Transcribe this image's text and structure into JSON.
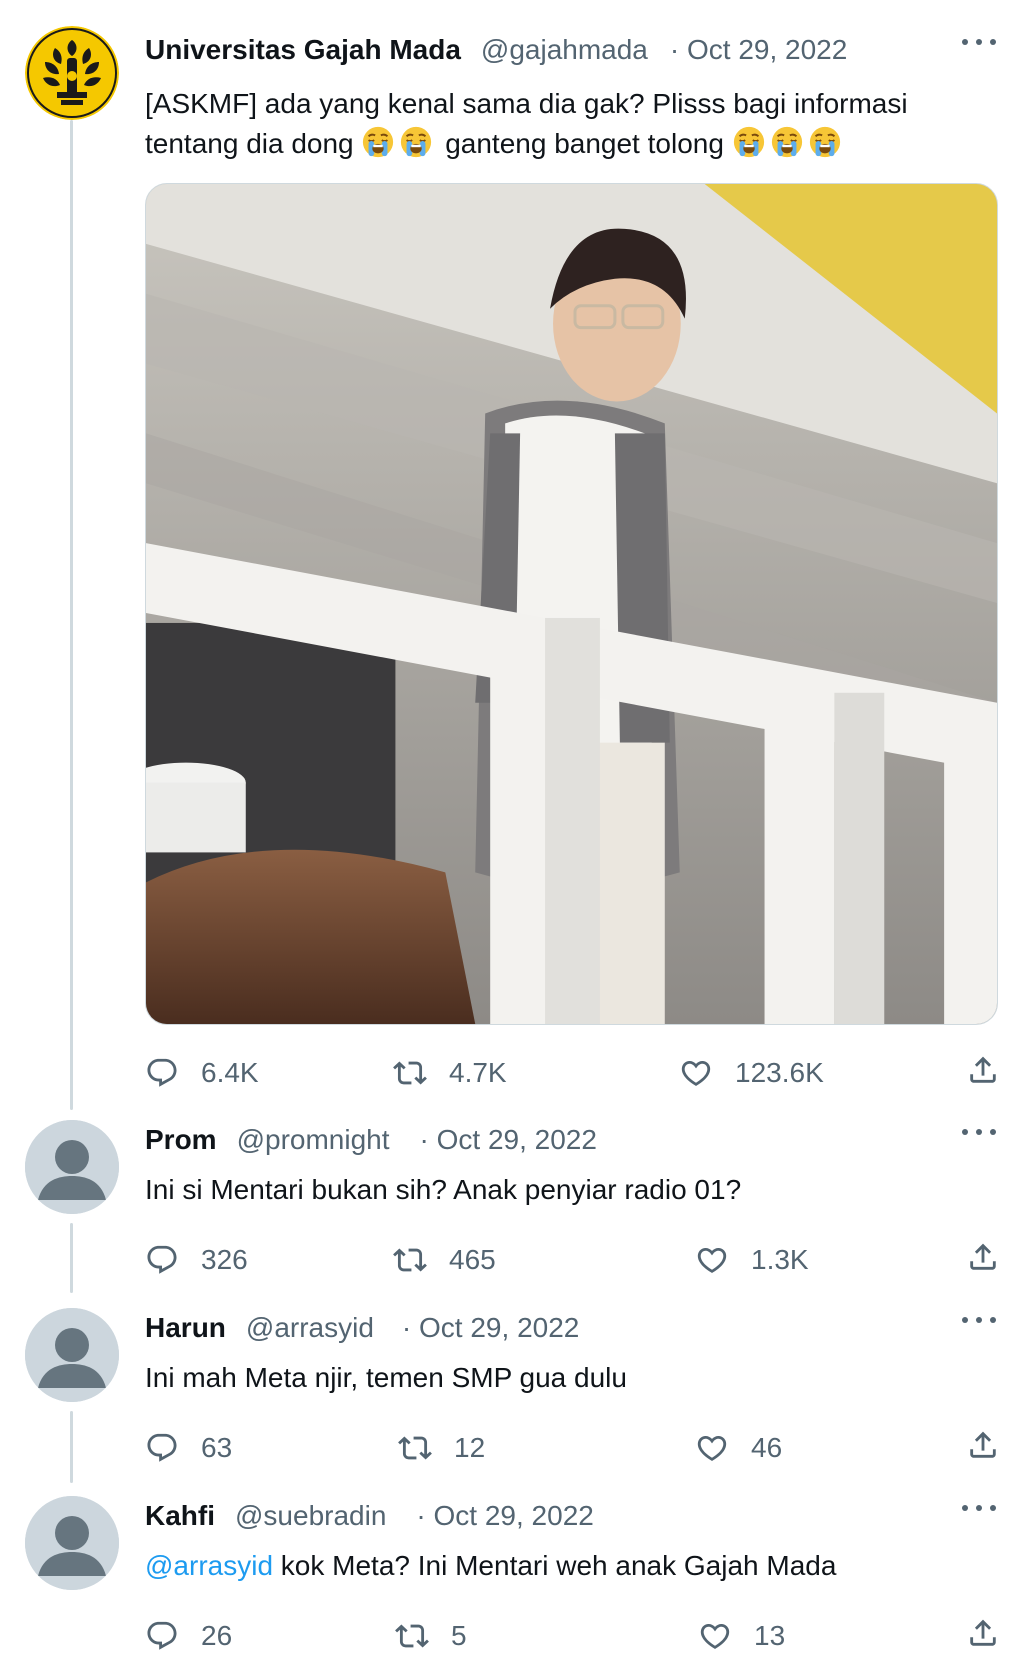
{
  "colors": {
    "text": "#0f1419",
    "secondary": "#536471",
    "mention": "#1d9bf0",
    "thread_line": "#cfd9de",
    "logo_yellow": "#f5c800"
  },
  "main_tweet": {
    "avatar_icon": "university-seal-logo",
    "name": "Universitas Gajah Mada",
    "handle": "@gajahmada",
    "date": "· Oct 29, 2022",
    "text_line1": "[ASKMF] ada yang kenal sama dia gak? Plisss bagi informasi",
    "text_line2_a": "tentang dia dong",
    "text_line2_b": "ganteng banget tolong",
    "emoji_icon": "loudly-crying-face-emoji",
    "media_icon": "photo-young-man-on-balcony",
    "stats": {
      "replies": "6.4K",
      "retweets": "4.7K",
      "likes": "123.6K"
    }
  },
  "replies": [
    {
      "name": "Prom",
      "handle": "@promnight",
      "date": "· Oct 29, 2022",
      "text": "Ini si Mentari bukan sih? Anak penyiar radio 01?",
      "stats": {
        "replies": "326",
        "retweets": "465",
        "likes": "1.3K"
      }
    },
    {
      "name": "Harun",
      "handle": "@arrasyid",
      "date": "· Oct 29, 2022",
      "text": "Ini mah Meta njir, temen SMP gua dulu",
      "stats": {
        "replies": "63",
        "retweets": "12",
        "likes": "46"
      }
    },
    {
      "name": "Kahfi",
      "handle": "@suebradin",
      "date": "· Oct 29, 2022",
      "mention": "@arrasyid",
      "text": " kok Meta? Ini Mentari weh anak Gajah Mada",
      "stats": {
        "replies": "26",
        "retweets": "5",
        "likes": "13"
      }
    }
  ],
  "icons": {
    "reply": "reply-bubble-icon",
    "retweet": "retweet-icon",
    "like": "heart-icon",
    "share": "share-icon",
    "more": "more-dots-icon",
    "default_avatar": "default-user-avatar-icon"
  }
}
